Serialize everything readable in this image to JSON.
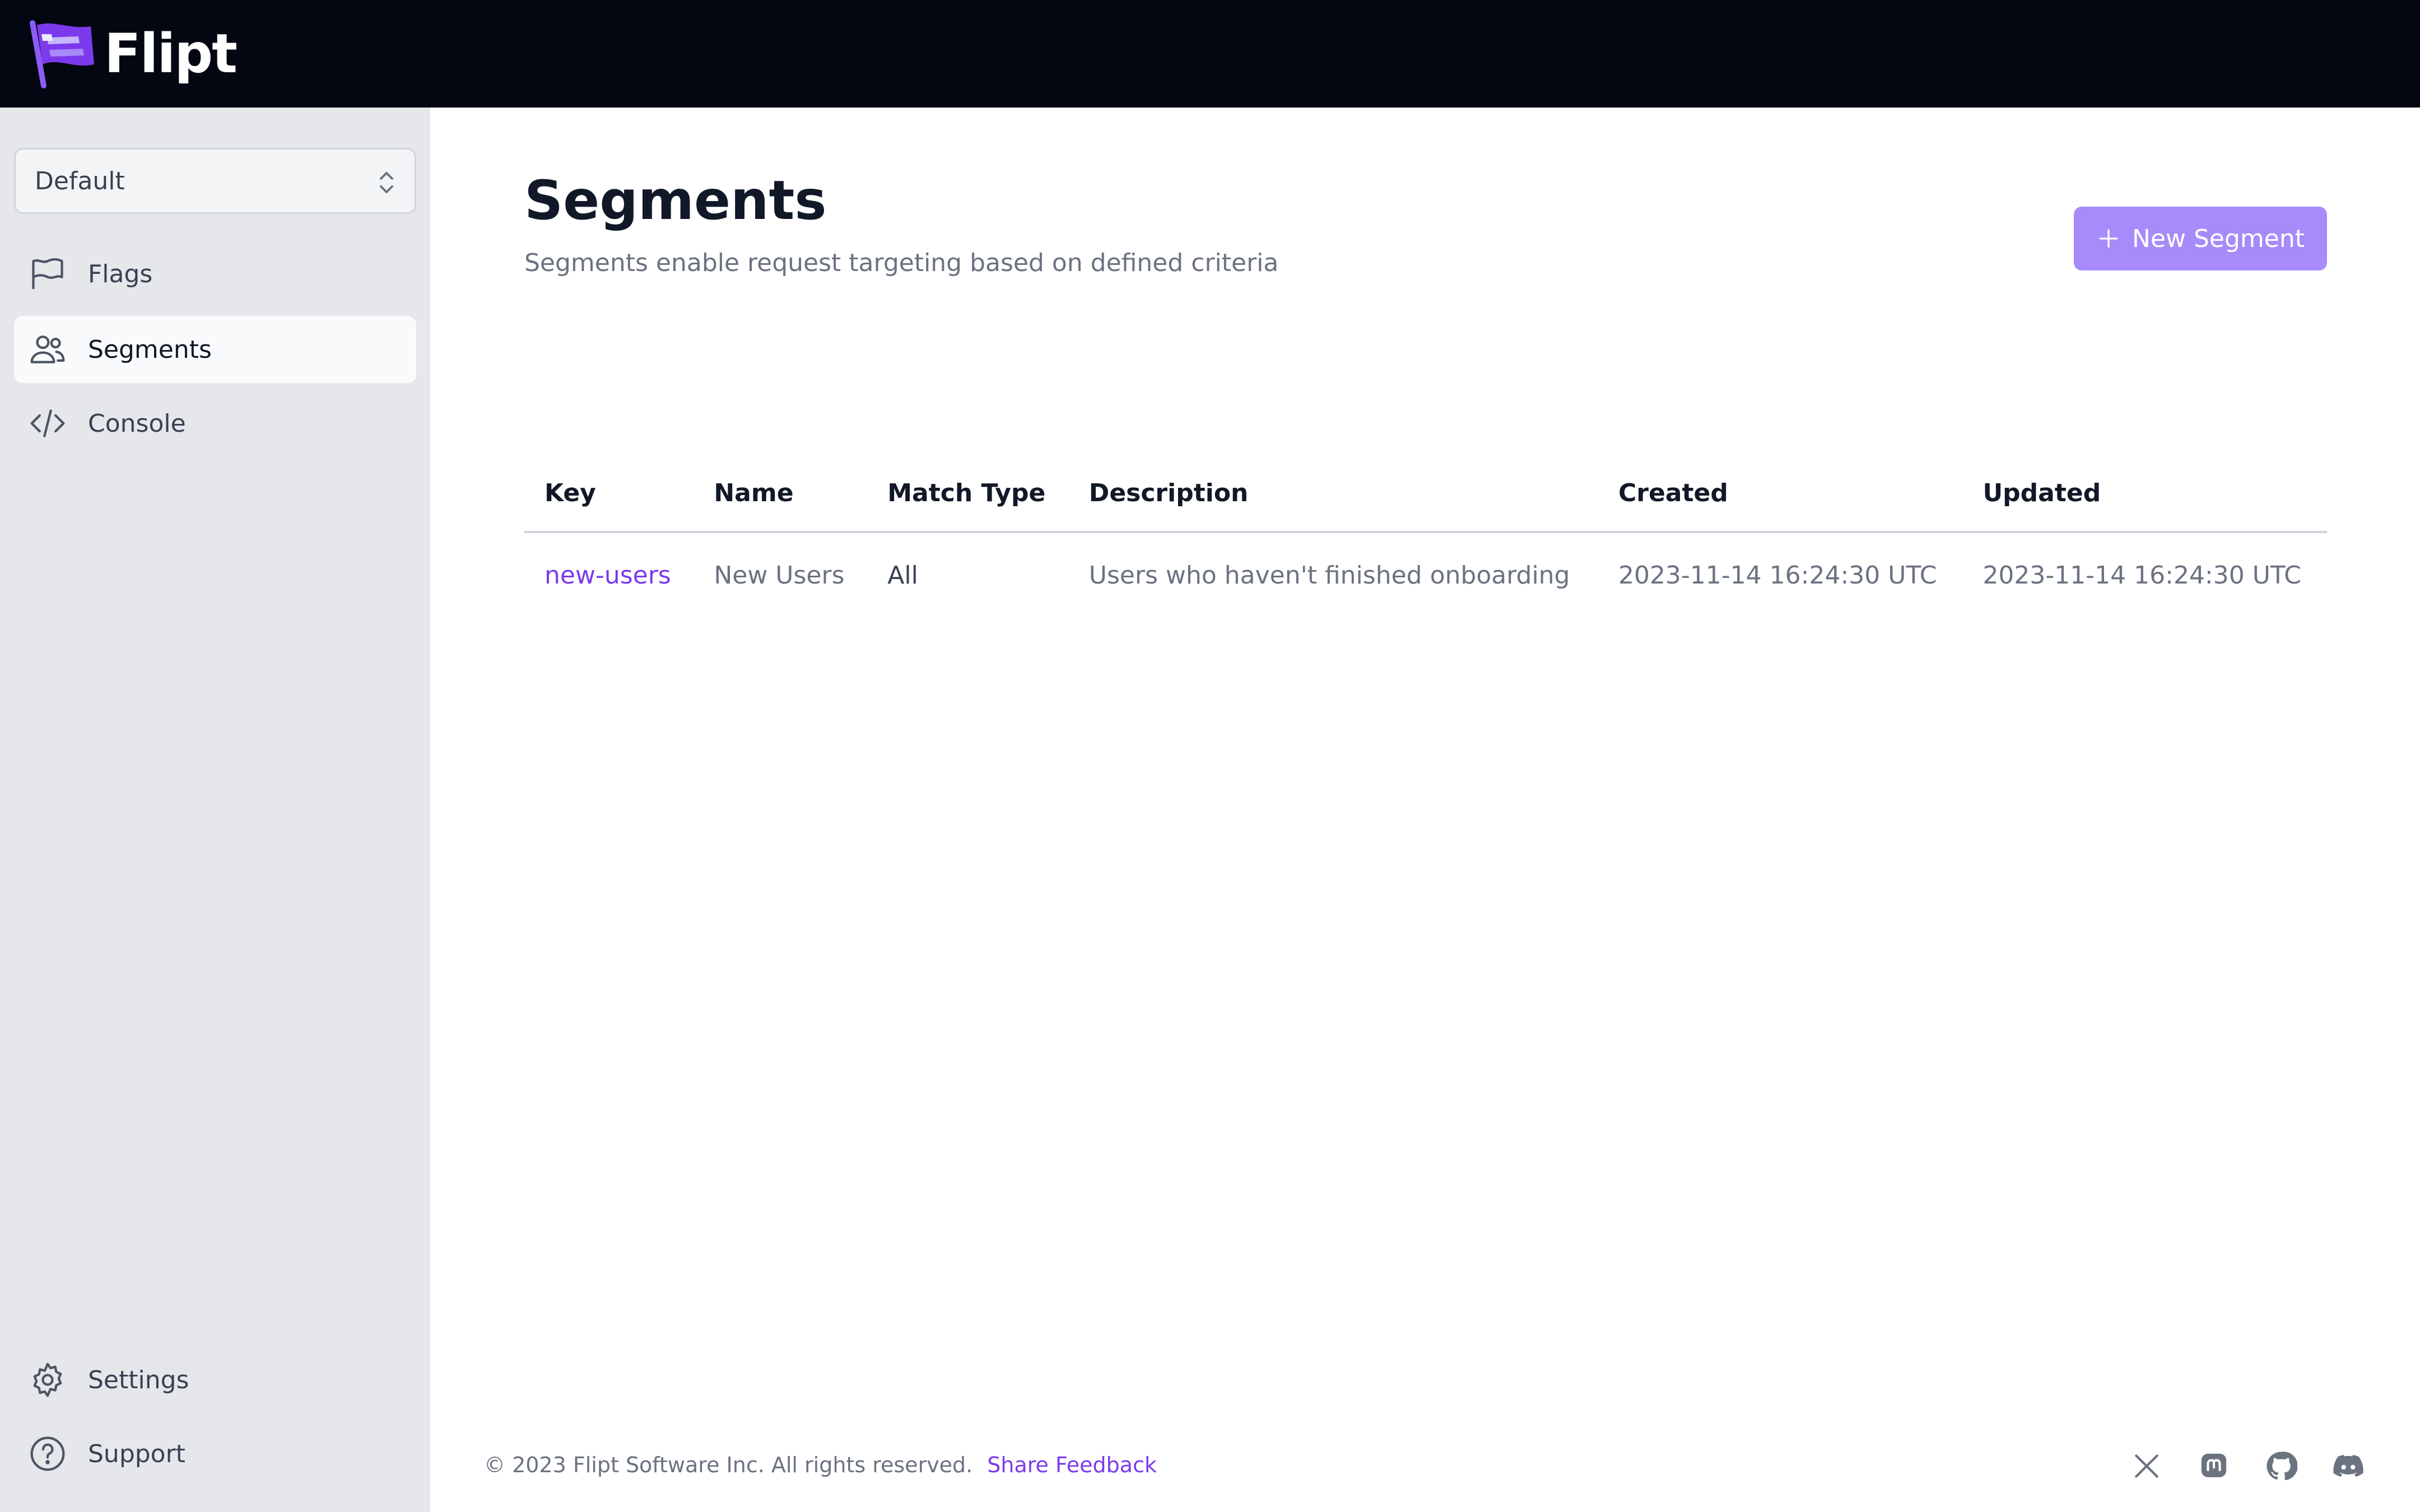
{
  "app": {
    "name": "Flipt"
  },
  "sidebar": {
    "namespace": "Default",
    "items": [
      {
        "label": "Flags",
        "icon": "flag-icon"
      },
      {
        "label": "Segments",
        "icon": "users-icon",
        "active": true
      },
      {
        "label": "Console",
        "icon": "code-icon"
      }
    ],
    "bottom_items": [
      {
        "label": "Settings",
        "icon": "gear-icon"
      },
      {
        "label": "Support",
        "icon": "question-circle-icon"
      }
    ]
  },
  "main": {
    "title": "Segments",
    "subtitle": "Segments enable request targeting based on defined criteria",
    "new_button": "New Segment",
    "table": {
      "headers": [
        "Key",
        "Name",
        "Match Type",
        "Description",
        "Created",
        "Updated"
      ],
      "rows": [
        {
          "key": "new-users",
          "name": "New Users",
          "match_type": "All",
          "description": "Users who haven't finished onboarding",
          "created": "2023-11-14 16:24:30 UTC",
          "updated": "2023-11-14 16:24:30 UTC"
        }
      ]
    }
  },
  "footer": {
    "copyright": "© 2023 Flipt Software Inc. All rights reserved.",
    "feedback": "Share Feedback",
    "social": [
      "x-icon",
      "mastodon-icon",
      "github-icon",
      "discord-icon"
    ]
  },
  "colors": {
    "topbar": "#030712",
    "sidebar": "#e5e7eb",
    "accent": "#7c3aed",
    "button": "#a78bfa"
  }
}
